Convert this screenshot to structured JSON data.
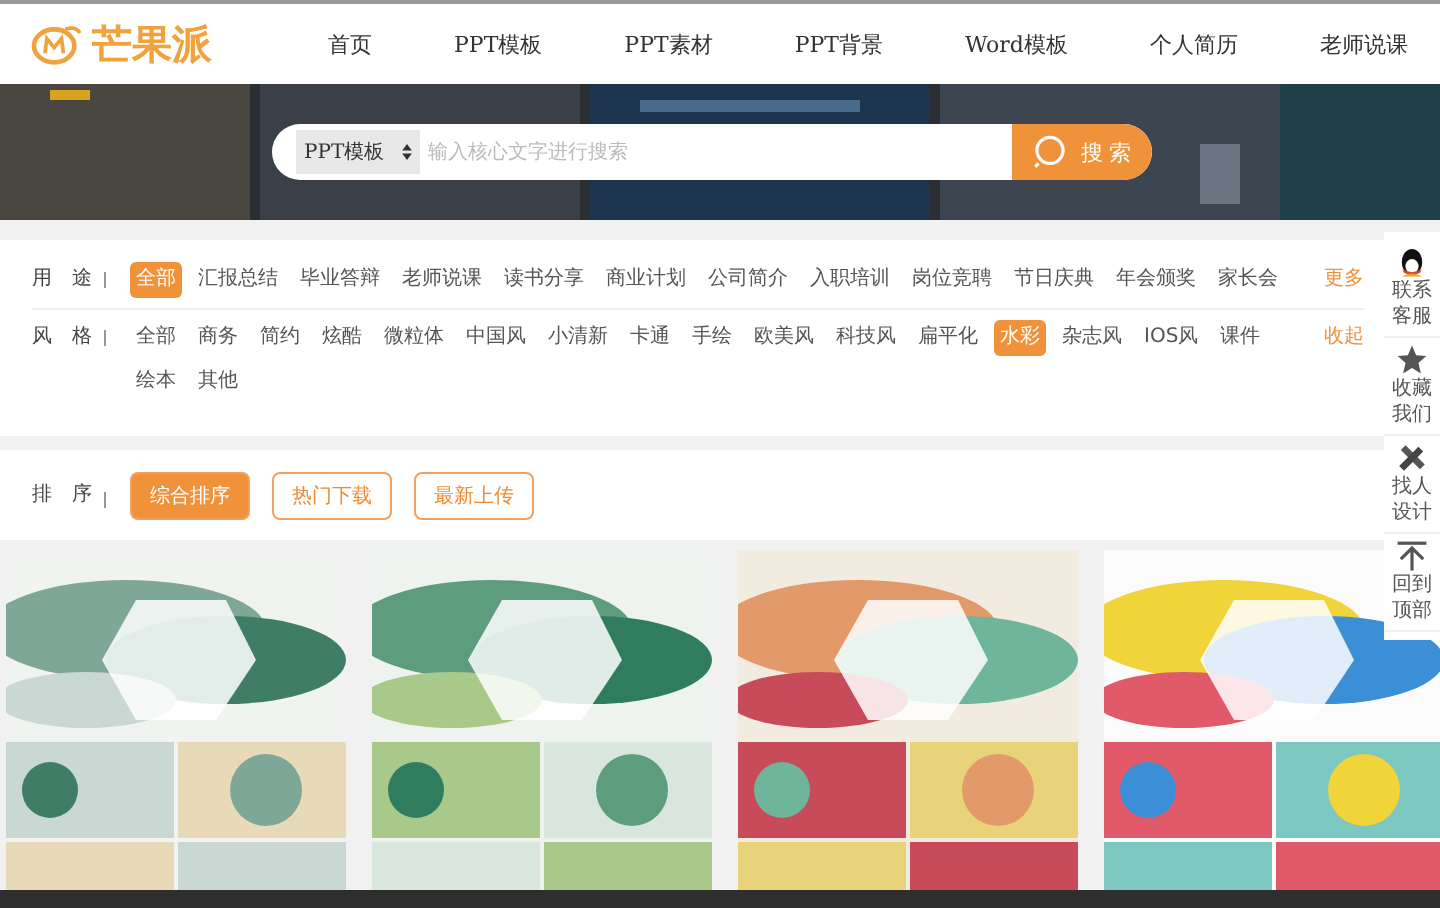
{
  "logo": {
    "text": "芒果派"
  },
  "nav": [
    "首页",
    "PPT模板",
    "PPT素材",
    "PPT背景",
    "Word模板",
    "个人简历",
    "老师说课"
  ],
  "search": {
    "category": "PPT模板",
    "placeholder": "输入核心文字进行搜索",
    "button": "搜 索"
  },
  "filters": [
    {
      "label": "用　途",
      "toggle": "更多",
      "options": [
        {
          "text": "全部",
          "selected": true
        },
        {
          "text": "汇报总结",
          "selected": false
        },
        {
          "text": "毕业答辩",
          "selected": false
        },
        {
          "text": "老师说课",
          "selected": false
        },
        {
          "text": "读书分享",
          "selected": false
        },
        {
          "text": "商业计划",
          "selected": false
        },
        {
          "text": "公司简介",
          "selected": false
        },
        {
          "text": "入职培训",
          "selected": false
        },
        {
          "text": "岗位竞聘",
          "selected": false
        },
        {
          "text": "节日庆典",
          "selected": false
        },
        {
          "text": "年会颁奖",
          "selected": false
        },
        {
          "text": "家长会",
          "selected": false
        }
      ]
    },
    {
      "label": "风　格",
      "toggle": "收起",
      "options": [
        {
          "text": "全部",
          "selected": false
        },
        {
          "text": "商务",
          "selected": false
        },
        {
          "text": "简约",
          "selected": false
        },
        {
          "text": "炫酷",
          "selected": false
        },
        {
          "text": "微粒体",
          "selected": false
        },
        {
          "text": "中国风",
          "selected": false
        },
        {
          "text": "小清新",
          "selected": false
        },
        {
          "text": "卡通",
          "selected": false
        },
        {
          "text": "手绘",
          "selected": false
        },
        {
          "text": "欧美风",
          "selected": false
        },
        {
          "text": "科技风",
          "selected": false
        },
        {
          "text": "扁平化",
          "selected": false
        },
        {
          "text": "水彩",
          "selected": true
        },
        {
          "text": "杂志风",
          "selected": false
        },
        {
          "text": "IOS风",
          "selected": false
        },
        {
          "text": "课件",
          "selected": false
        },
        {
          "text": "绘本",
          "selected": false
        },
        {
          "text": "其他",
          "selected": false
        }
      ]
    }
  ],
  "sort": {
    "label": "排　序",
    "options": [
      {
        "text": "综合排序",
        "selected": true
      },
      {
        "text": "热门下载",
        "selected": false
      },
      {
        "text": "最新上传",
        "selected": false
      }
    ]
  },
  "sidebar": [
    {
      "kind": "penguin",
      "text": "联系客服"
    },
    {
      "kind": "star",
      "text": "收藏我们"
    },
    {
      "kind": "tools",
      "text": "找人设计"
    },
    {
      "kind": "top",
      "text": "回到顶部"
    }
  ]
}
